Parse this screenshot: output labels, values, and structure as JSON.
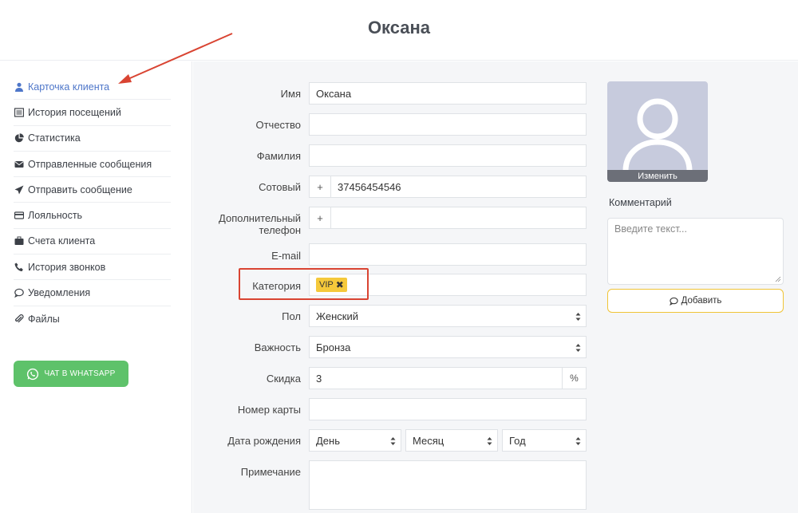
{
  "page": {
    "title": "Оксана"
  },
  "sidebar": {
    "items": [
      {
        "label": "Карточка клиента",
        "icon": "user-icon"
      },
      {
        "label": "История посещений",
        "icon": "list-icon"
      },
      {
        "label": "Статистика",
        "icon": "pie-chart-icon"
      },
      {
        "label": "Отправленные сообщения",
        "icon": "envelope-icon"
      },
      {
        "label": "Отправить сообщение",
        "icon": "paper-plane-icon"
      },
      {
        "label": "Лояльность",
        "icon": "credit-card-icon"
      },
      {
        "label": "Счета клиента",
        "icon": "briefcase-icon"
      },
      {
        "label": "История звонков",
        "icon": "phone-icon"
      },
      {
        "label": "Уведомления",
        "icon": "comment-icon"
      },
      {
        "label": "Файлы",
        "icon": "paperclip-icon"
      }
    ],
    "whatsapp_label": "ЧАТ В WHATSAPP"
  },
  "form": {
    "name": {
      "label": "Имя",
      "value": "Оксана"
    },
    "patronymic": {
      "label": "Отчество",
      "value": ""
    },
    "surname": {
      "label": "Фамилия",
      "value": ""
    },
    "mobile": {
      "label": "Сотовый",
      "prefix": "+",
      "value": "37456454546"
    },
    "extra_phone": {
      "label": "Дополнительный телефон",
      "prefix": "+",
      "value": ""
    },
    "email": {
      "label": "E-mail",
      "value": ""
    },
    "category": {
      "label": "Категория",
      "tag": "VIP",
      "remove": "✖"
    },
    "gender": {
      "label": "Пол",
      "value": "Женский"
    },
    "importance": {
      "label": "Важность",
      "value": "Бронза"
    },
    "discount": {
      "label": "Скидка",
      "value": "3",
      "suffix": "%"
    },
    "card_number": {
      "label": "Номер карты",
      "value": ""
    },
    "birthdate": {
      "label": "Дата рождения",
      "day": "День",
      "month": "Месяц",
      "year": "Год"
    },
    "note": {
      "label": "Примечание",
      "value": ""
    }
  },
  "avatar": {
    "change_label": "Изменить"
  },
  "comment": {
    "title": "Комментарий",
    "placeholder": "Введите текст...",
    "add_label": "Добавить"
  },
  "colors": {
    "accent_blue": "#4e76c9",
    "whatsapp_green": "#5ec26a",
    "tag_yellow": "#f5c93b",
    "annotation_red": "#d94432"
  }
}
